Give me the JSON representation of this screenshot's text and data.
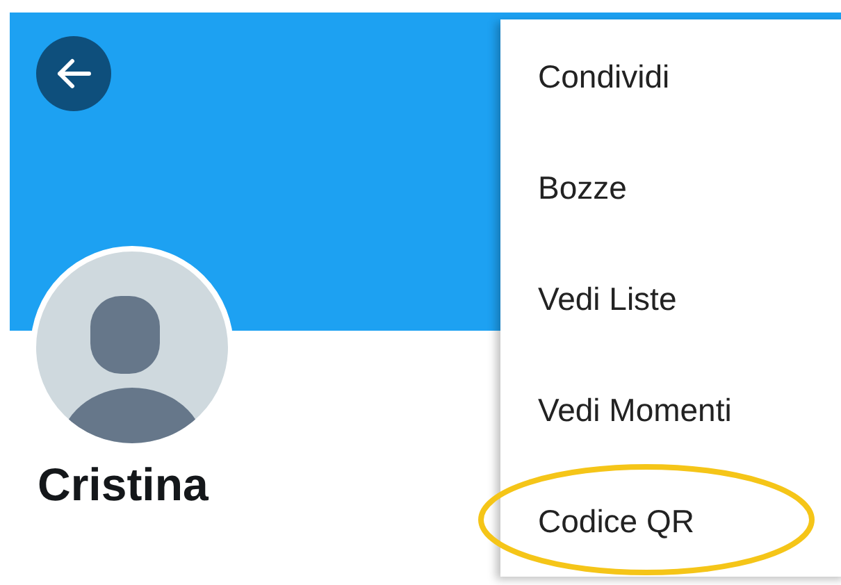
{
  "profile": {
    "name": "Cristina"
  },
  "menu": {
    "items": [
      {
        "label": "Condividi",
        "highlighted": false
      },
      {
        "label": "Bozze",
        "highlighted": false
      },
      {
        "label": "Vedi Liste",
        "highlighted": false
      },
      {
        "label": "Vedi Momenti",
        "highlighted": false
      },
      {
        "label": "Codice QR",
        "highlighted": true
      }
    ]
  }
}
